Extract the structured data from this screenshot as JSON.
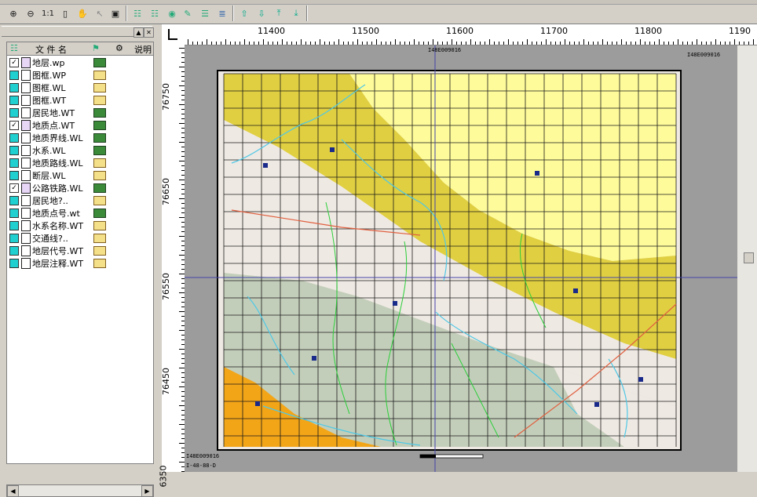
{
  "toolbar": {
    "buttons": [
      "zoom-in",
      "zoom-out",
      "zoom-1-1",
      "pan-hand",
      "pointer",
      "fit-window",
      "select-add",
      "select-remove",
      "layer-dig",
      "layer-edit",
      "layer-prop",
      "layer-lock",
      "layer-up",
      "layer-down",
      "layer-top",
      "layer-bottom"
    ],
    "zoom_1_1_label": "1:1"
  },
  "panel": {
    "header_col_filename": "文 件 名",
    "header_col_desc": "说明"
  },
  "layers": [
    {
      "name": "地层.wp",
      "checked": true,
      "type": "wp"
    },
    {
      "name": "图框.WP",
      "checked": false,
      "type": "folder"
    },
    {
      "name": "图框.WL",
      "checked": false,
      "type": "folder"
    },
    {
      "name": "图框.WT",
      "checked": false,
      "type": "folder"
    },
    {
      "name": "居民地.WT",
      "checked": false,
      "type": "wp"
    },
    {
      "name": "地质点.WT",
      "checked": true,
      "type": "wp"
    },
    {
      "name": "地质界线.WL",
      "checked": false,
      "type": "wp"
    },
    {
      "name": "水系.WL",
      "checked": false,
      "type": "wp"
    },
    {
      "name": "地质路线.WL",
      "checked": false,
      "type": "folder"
    },
    {
      "name": "断层.WL",
      "checked": false,
      "type": "folder"
    },
    {
      "name": "公路铁路.WL",
      "checked": true,
      "type": "wp"
    },
    {
      "name": "居民地?..",
      "checked": false,
      "type": "folder"
    },
    {
      "name": "地质点号.wt",
      "checked": false,
      "type": "wp"
    },
    {
      "name": "水系名称.WT",
      "checked": false,
      "type": "folder"
    },
    {
      "name": "交通线?..",
      "checked": false,
      "type": "folder"
    },
    {
      "name": "地层代号.WT",
      "checked": false,
      "type": "folder"
    },
    {
      "name": "地层注释.WT",
      "checked": false,
      "type": "folder"
    }
  ],
  "ruler": {
    "top_labels": [
      "11400",
      "11500",
      "11600",
      "11700",
      "11800",
      "1190"
    ],
    "left_labels": [
      "76750",
      "76650",
      "76550",
      "76450",
      "6350"
    ]
  },
  "map": {
    "sheet_code_top": "I48E009016",
    "sheet_code_right": "I48E009016",
    "sheet_code_bottom": "I48E009016",
    "sheet_code_bottom2": "I-48-88-D"
  },
  "colors": {
    "zone_yellow_light": "#fefb9a",
    "zone_yellow_dark": "#e0cf41",
    "zone_beige": "#efe9e3",
    "zone_gray_green": "#c3ceba",
    "zone_orange": "#f3a518",
    "canvas_bg": "#9c9c9c",
    "grid": "#1a1a1a",
    "river": "#4ec8e6",
    "boundary": "#2bcf3a",
    "road": "#e06040"
  }
}
